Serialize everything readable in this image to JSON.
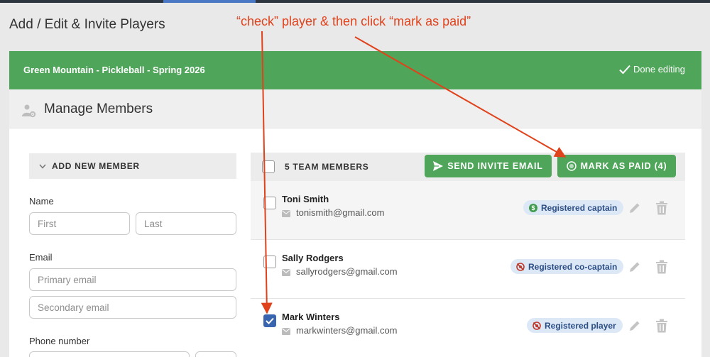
{
  "page": {
    "title": "Add / Edit & Invite Players"
  },
  "annotation": {
    "text": "“check” player & then click “mark as paid”"
  },
  "header": {
    "team_name": "Green Mountain - Pickleball - Spring 2026",
    "done_label": "Done editing"
  },
  "manage": {
    "title": "Manage Members"
  },
  "add_member": {
    "toggle_label": "ADD NEW MEMBER",
    "name_label": "Name",
    "first_placeholder": "First",
    "last_placeholder": "Last",
    "email_label": "Email",
    "primary_email_placeholder": "Primary email",
    "secondary_email_placeholder": "Secondary email",
    "phone_label": "Phone number"
  },
  "members": {
    "count_label": "5 TEAM MEMBERS",
    "send_invite_label": "SEND INVITE EMAIL",
    "mark_paid_label": "MARK AS PAID (4)",
    "rows": [
      {
        "name": "Toni Smith",
        "email": "tonismith@gmail.com",
        "status": "Registered captain",
        "paid": true,
        "checked": false
      },
      {
        "name": "Sally Rodgers",
        "email": "sallyrodgers@gmail.com",
        "status": "Registered co-captain",
        "paid": false,
        "checked": false
      },
      {
        "name": "Mark Winters",
        "email": "markwinters@gmail.com",
        "status": "Registered player",
        "paid": false,
        "checked": true
      }
    ]
  },
  "colors": {
    "brand_green": "#4fa65a",
    "annotation_red": "#e0421b",
    "checkbox_blue": "#3965b0",
    "badge_bg": "#dde8f6",
    "paid_green": "#3f9b4d",
    "unpaid_red": "#c0392b"
  },
  "icons": {
    "done": "check-icon",
    "manage": "user-gear-icon",
    "toggle": "chevron-down-icon",
    "send": "paper-plane-icon",
    "pay": "coin-icon",
    "mail": "envelope-icon",
    "edit": "pencil-icon",
    "delete": "trash-icon",
    "paid": "dollar-circle-icon",
    "unpaid": "no-money-icon"
  }
}
